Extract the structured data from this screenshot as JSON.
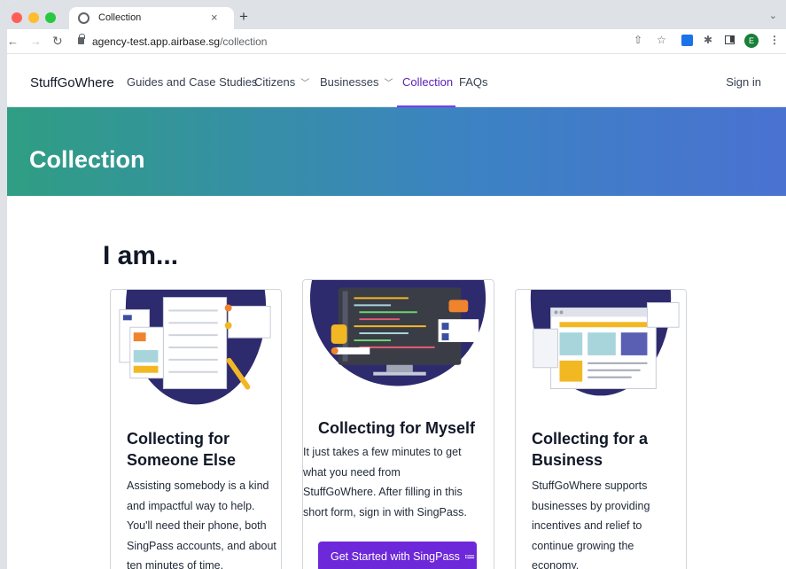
{
  "browser": {
    "tab_title": "Collection",
    "tab_close": "×",
    "new_tab": "+",
    "url_host": "agency-test.app.airbase.sg",
    "url_path": "/collection",
    "avatar_letter": "E"
  },
  "nav": {
    "brand": "StuffGoWhere",
    "items": [
      "Guides and Case Studies",
      "Citizens",
      "Businesses",
      "Collection",
      "FAQs"
    ],
    "sign_in": "Sign in",
    "active": "Collection"
  },
  "hero": {
    "title": "Collection"
  },
  "section": {
    "heading": "I am..."
  },
  "cards": [
    {
      "title": "Collecting for Someone Else",
      "text": "Assisting somebody is a kind and impactful way to help. You'll need their phone, both SingPass accounts, and about ten minutes of time."
    },
    {
      "title": "Collecting for Myself",
      "text": "It just takes a few minutes to get what you need from StuffGoWhere. After filling in this short form, sign in with SingPass.",
      "button": "Get Started with SingPass",
      "button_icon": "≔"
    },
    {
      "title": "Collecting for a Business",
      "text": "StuffGoWhere supports businesses by providing incentives and relief to continue growing the economy."
    }
  ],
  "colors": {
    "accent": "#6d28d9",
    "hero_start": "#2f9e83",
    "hero_end": "#4a72d1",
    "illustration_navy": "#2e2a6e"
  }
}
